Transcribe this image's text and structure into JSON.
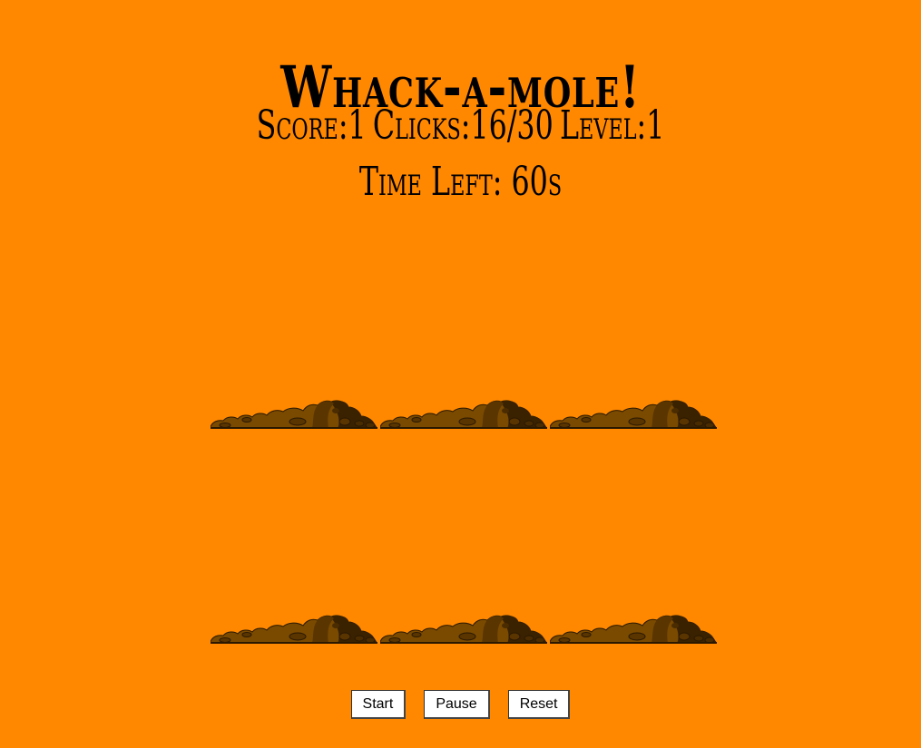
{
  "game": {
    "title": "Whack-a-mole!",
    "score_label": "Score:",
    "score": "1",
    "clicks_label": "Clicks:",
    "clicks": "16/30",
    "level_label": "Level:",
    "level": "1",
    "time_label": "Time Left:",
    "time_left": "60s"
  },
  "board": {
    "holes": [
      {
        "id": "1",
        "mole_visible": false
      },
      {
        "id": "2",
        "mole_visible": false
      },
      {
        "id": "3",
        "mole_visible": false
      },
      {
        "id": "4",
        "mole_visible": false
      },
      {
        "id": "5",
        "mole_visible": false
      },
      {
        "id": "6",
        "mole_visible": false
      }
    ],
    "dirt_colors": {
      "light": "#7a4a00",
      "dark": "#3a2200",
      "outline": "#2a1800"
    }
  },
  "controls": {
    "start_label": "Start",
    "pause_label": "Pause",
    "reset_label": "Reset"
  },
  "theme": {
    "background": "#ff8800"
  }
}
